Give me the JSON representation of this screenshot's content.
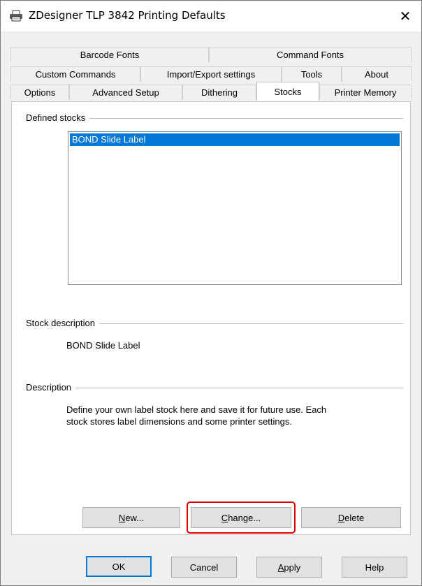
{
  "window": {
    "title": "ZDesigner TLP 3842 Printing Defaults",
    "close_glyph": "✕"
  },
  "tabs": {
    "row1": [
      "Barcode Fonts",
      "Command Fonts"
    ],
    "row2": [
      "Custom Commands",
      "Import/Export settings",
      "Tools",
      "About"
    ],
    "row3": [
      "Options",
      "Advanced Setup",
      "Dithering",
      "Stocks",
      "Printer Memory"
    ],
    "active": "Stocks"
  },
  "defined_stocks": {
    "label": "Defined stocks",
    "items": [
      "BOND Slide Label"
    ],
    "selected": "BOND Slide Label"
  },
  "stock_description": {
    "label": "Stock description",
    "value": "BOND Slide Label"
  },
  "description": {
    "label": "Description",
    "line1": "Define your own label stock here and save it for future use. Each",
    "line2": "stock stores label dimensions and some printer settings."
  },
  "stock_buttons": {
    "new": {
      "mnemonic": "N",
      "rest": "ew..."
    },
    "change": {
      "mnemonic": "C",
      "rest": "hange..."
    },
    "delete": {
      "mnemonic": "D",
      "rest": "elete"
    }
  },
  "dialog_buttons": {
    "ok": "OK",
    "cancel": "Cancel",
    "apply": {
      "mnemonic": "A",
      "rest": "pply"
    },
    "help": "Help"
  },
  "colors": {
    "selection": "#0078d7",
    "highlight_box": "#e00000"
  },
  "icons": {
    "title": "printer-icon"
  }
}
